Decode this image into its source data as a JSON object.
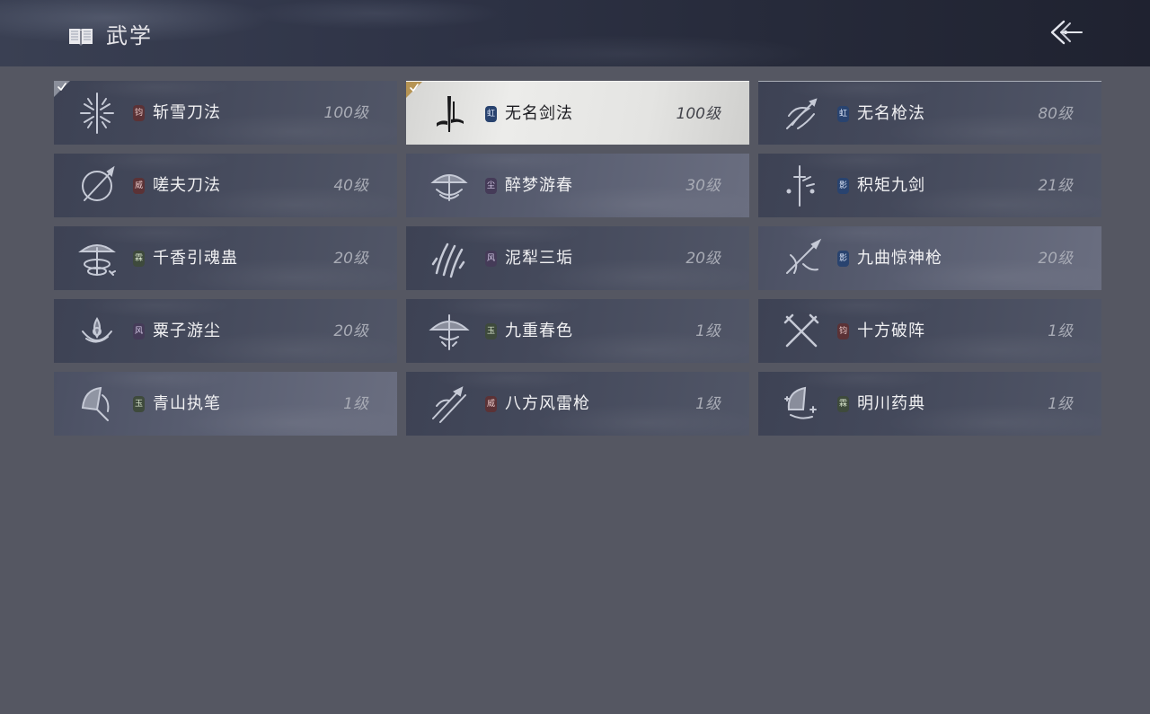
{
  "header": {
    "title": "武学",
    "book_icon": "book-icon",
    "back_icon": "back-arrow-icon"
  },
  "colors": {
    "background": "#555762",
    "selected_card": "#e6e6e4",
    "check_gold": "#b69454",
    "check_gray": "#8b8f9b"
  },
  "skills": [
    {
      "name": "斩雪刀法",
      "level": "100级",
      "badge": "钧",
      "badge_color": "red",
      "icon": "snowflake-blade-icon",
      "equipped": true,
      "selected": false,
      "style": "dark"
    },
    {
      "name": "无名剑法",
      "level": "100级",
      "badge": "虹",
      "badge_color": "blue",
      "icon": "ink-sword-icon",
      "equipped": true,
      "selected": true,
      "style": "selected"
    },
    {
      "name": "无名枪法",
      "level": "80级",
      "badge": "虹",
      "badge_color": "blue",
      "icon": "spear-swirl-icon",
      "equipped": false,
      "selected": false,
      "style": "dark"
    },
    {
      "name": "嗟夫刀法",
      "level": "40级",
      "badge": "威",
      "badge_color": "red",
      "icon": "circle-blade-icon",
      "equipped": false,
      "selected": false,
      "style": "dark"
    },
    {
      "name": "醉梦游春",
      "level": "30级",
      "badge": "尘",
      "badge_color": "purple",
      "icon": "umbrella-swirl-icon",
      "equipped": false,
      "selected": false,
      "style": "light"
    },
    {
      "name": "积矩九剑",
      "level": "21级",
      "badge": "影",
      "badge_color": "blue",
      "icon": "sword-stars-icon",
      "equipped": false,
      "selected": false,
      "style": "dark"
    },
    {
      "name": "千香引魂蛊",
      "level": "20级",
      "badge": "霖",
      "badge_color": "green",
      "icon": "parasol-spiral-icon",
      "equipped": false,
      "selected": false,
      "style": "dark"
    },
    {
      "name": "泥犁三垢",
      "level": "20级",
      "badge": "风",
      "badge_color": "purple",
      "icon": "claw-slash-icon",
      "equipped": false,
      "selected": false,
      "style": "dark"
    },
    {
      "name": "九曲惊神枪",
      "level": "20级",
      "badge": "影",
      "badge_color": "blue",
      "icon": "crossed-spear-icon",
      "equipped": false,
      "selected": false,
      "style": "light"
    },
    {
      "name": "粟子游尘",
      "level": "20级",
      "badge": "风",
      "badge_color": "purple",
      "icon": "lotus-swirl-icon",
      "equipped": false,
      "selected": false,
      "style": "dark"
    },
    {
      "name": "九重春色",
      "level": "1级",
      "badge": "玉",
      "badge_color": "green",
      "icon": "parasol-icon",
      "equipped": false,
      "selected": false,
      "style": "dark"
    },
    {
      "name": "十方破阵",
      "level": "1级",
      "badge": "钧",
      "badge_color": "red",
      "icon": "crossed-blades-icon",
      "equipped": false,
      "selected": false,
      "style": "dark"
    },
    {
      "name": "青山执笔",
      "level": "1级",
      "badge": "玉",
      "badge_color": "green",
      "icon": "fan-brush-icon",
      "equipped": false,
      "selected": false,
      "style": "light"
    },
    {
      "name": "八方风雷枪",
      "level": "1级",
      "badge": "威",
      "badge_color": "red",
      "icon": "triple-spear-icon",
      "equipped": false,
      "selected": false,
      "style": "dark"
    },
    {
      "name": "明川药典",
      "level": "1级",
      "badge": "霖",
      "badge_color": "green",
      "icon": "fan-sparkle-icon",
      "equipped": false,
      "selected": false,
      "style": "dark"
    }
  ]
}
